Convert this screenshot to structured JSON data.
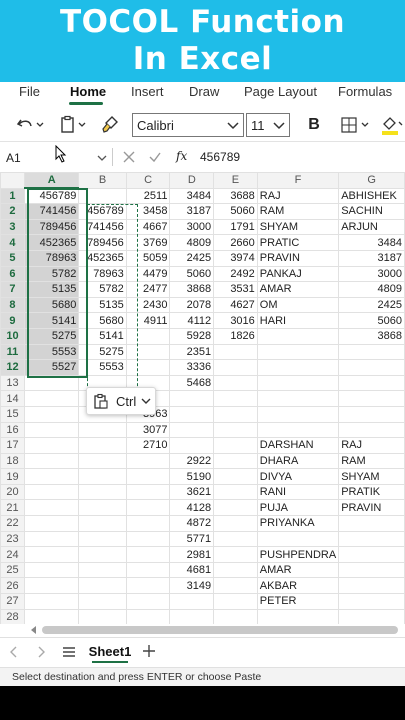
{
  "banner": {
    "line1": "TOCOL Function",
    "line2": "In Excel"
  },
  "ribbon": {
    "tabs": [
      "File",
      "Home",
      "Insert",
      "Draw",
      "Page Layout",
      "Formulas"
    ],
    "active": "Home"
  },
  "toolbar": {
    "font_name": "Calibri",
    "font_size": "11",
    "bold_label": "B"
  },
  "formula_bar": {
    "name_box": "A1",
    "fx_label": "fx",
    "value": "456789"
  },
  "columns": [
    "A",
    "B",
    "C",
    "D",
    "E",
    "F",
    "G"
  ],
  "rows": [
    [
      "456789",
      "",
      "2511",
      "3484",
      "3688",
      "RAJ",
      "ABHISHEK"
    ],
    [
      "741456",
      "456789",
      "3458",
      "3187",
      "5060",
      "RAM",
      "SACHIN"
    ],
    [
      "789456",
      "741456",
      "4667",
      "3000",
      "1791",
      "SHYAM",
      "ARJUN"
    ],
    [
      "452365",
      "789456",
      "3769",
      "4809",
      "2660",
      "PRATIC",
      "3484"
    ],
    [
      "78963",
      "452365",
      "5059",
      "2425",
      "3974",
      "PRAVIN",
      "3187"
    ],
    [
      "5782",
      "78963",
      "4479",
      "5060",
      "2492",
      "PANKAJ",
      "3000"
    ],
    [
      "5135",
      "5782",
      "2477",
      "3868",
      "3531",
      "AMAR",
      "4809"
    ],
    [
      "5680",
      "5135",
      "2430",
      "2078",
      "4627",
      "OM",
      "2425"
    ],
    [
      "5141",
      "5680",
      "4911",
      "4112",
      "3016",
      "HARI",
      "5060"
    ],
    [
      "5275",
      "5141",
      "",
      "5928",
      "1826",
      "",
      "3868"
    ],
    [
      "5553",
      "5275",
      "",
      "2351",
      "",
      "",
      ""
    ],
    [
      "5527",
      "5553",
      "",
      "3336",
      "",
      "",
      ""
    ],
    [
      "",
      "",
      "",
      "5468",
      "",
      "",
      ""
    ],
    [
      "",
      "",
      "",
      "",
      "",
      "",
      ""
    ],
    [
      "",
      "",
      "3963",
      "",
      "",
      "",
      ""
    ],
    [
      "",
      "",
      "3077",
      "",
      "",
      "",
      ""
    ],
    [
      "",
      "",
      "2710",
      "",
      "",
      "DARSHAN",
      "RAJ"
    ],
    [
      "",
      "",
      "",
      "2922",
      "",
      "DHARA",
      "RAM"
    ],
    [
      "",
      "",
      "",
      "5190",
      "",
      "DIVYA",
      "SHYAM"
    ],
    [
      "",
      "",
      "",
      "3621",
      "",
      "RANI",
      "PRATIK"
    ],
    [
      "",
      "",
      "",
      "4128",
      "",
      "PUJA",
      "PRAVIN"
    ],
    [
      "",
      "",
      "",
      "4872",
      "",
      "PRIYANKA",
      ""
    ],
    [
      "",
      "",
      "",
      "5771",
      "",
      "",
      ""
    ],
    [
      "",
      "",
      "",
      "2981",
      "",
      "PUSHPENDRA",
      ""
    ],
    [
      "",
      "",
      "",
      "4681",
      "",
      "AMAR",
      ""
    ],
    [
      "",
      "",
      "",
      "3149",
      "",
      "AKBAR",
      ""
    ],
    [
      "",
      "",
      "",
      "",
      "",
      "PETER",
      ""
    ],
    [
      "",
      "",
      "",
      "",
      "",
      "",
      ""
    ]
  ],
  "selection": {
    "range": "A1:A12",
    "copy_range": "B2:B13"
  },
  "paste_popup": {
    "label": "Ctrl"
  },
  "sheets": {
    "active": "Sheet1"
  },
  "status": {
    "message": "Select destination and press ENTER or choose Paste"
  },
  "colors": {
    "banner": "#1fbde8",
    "accent": "#1e7145",
    "selection_fill": "#d3d3d3"
  }
}
